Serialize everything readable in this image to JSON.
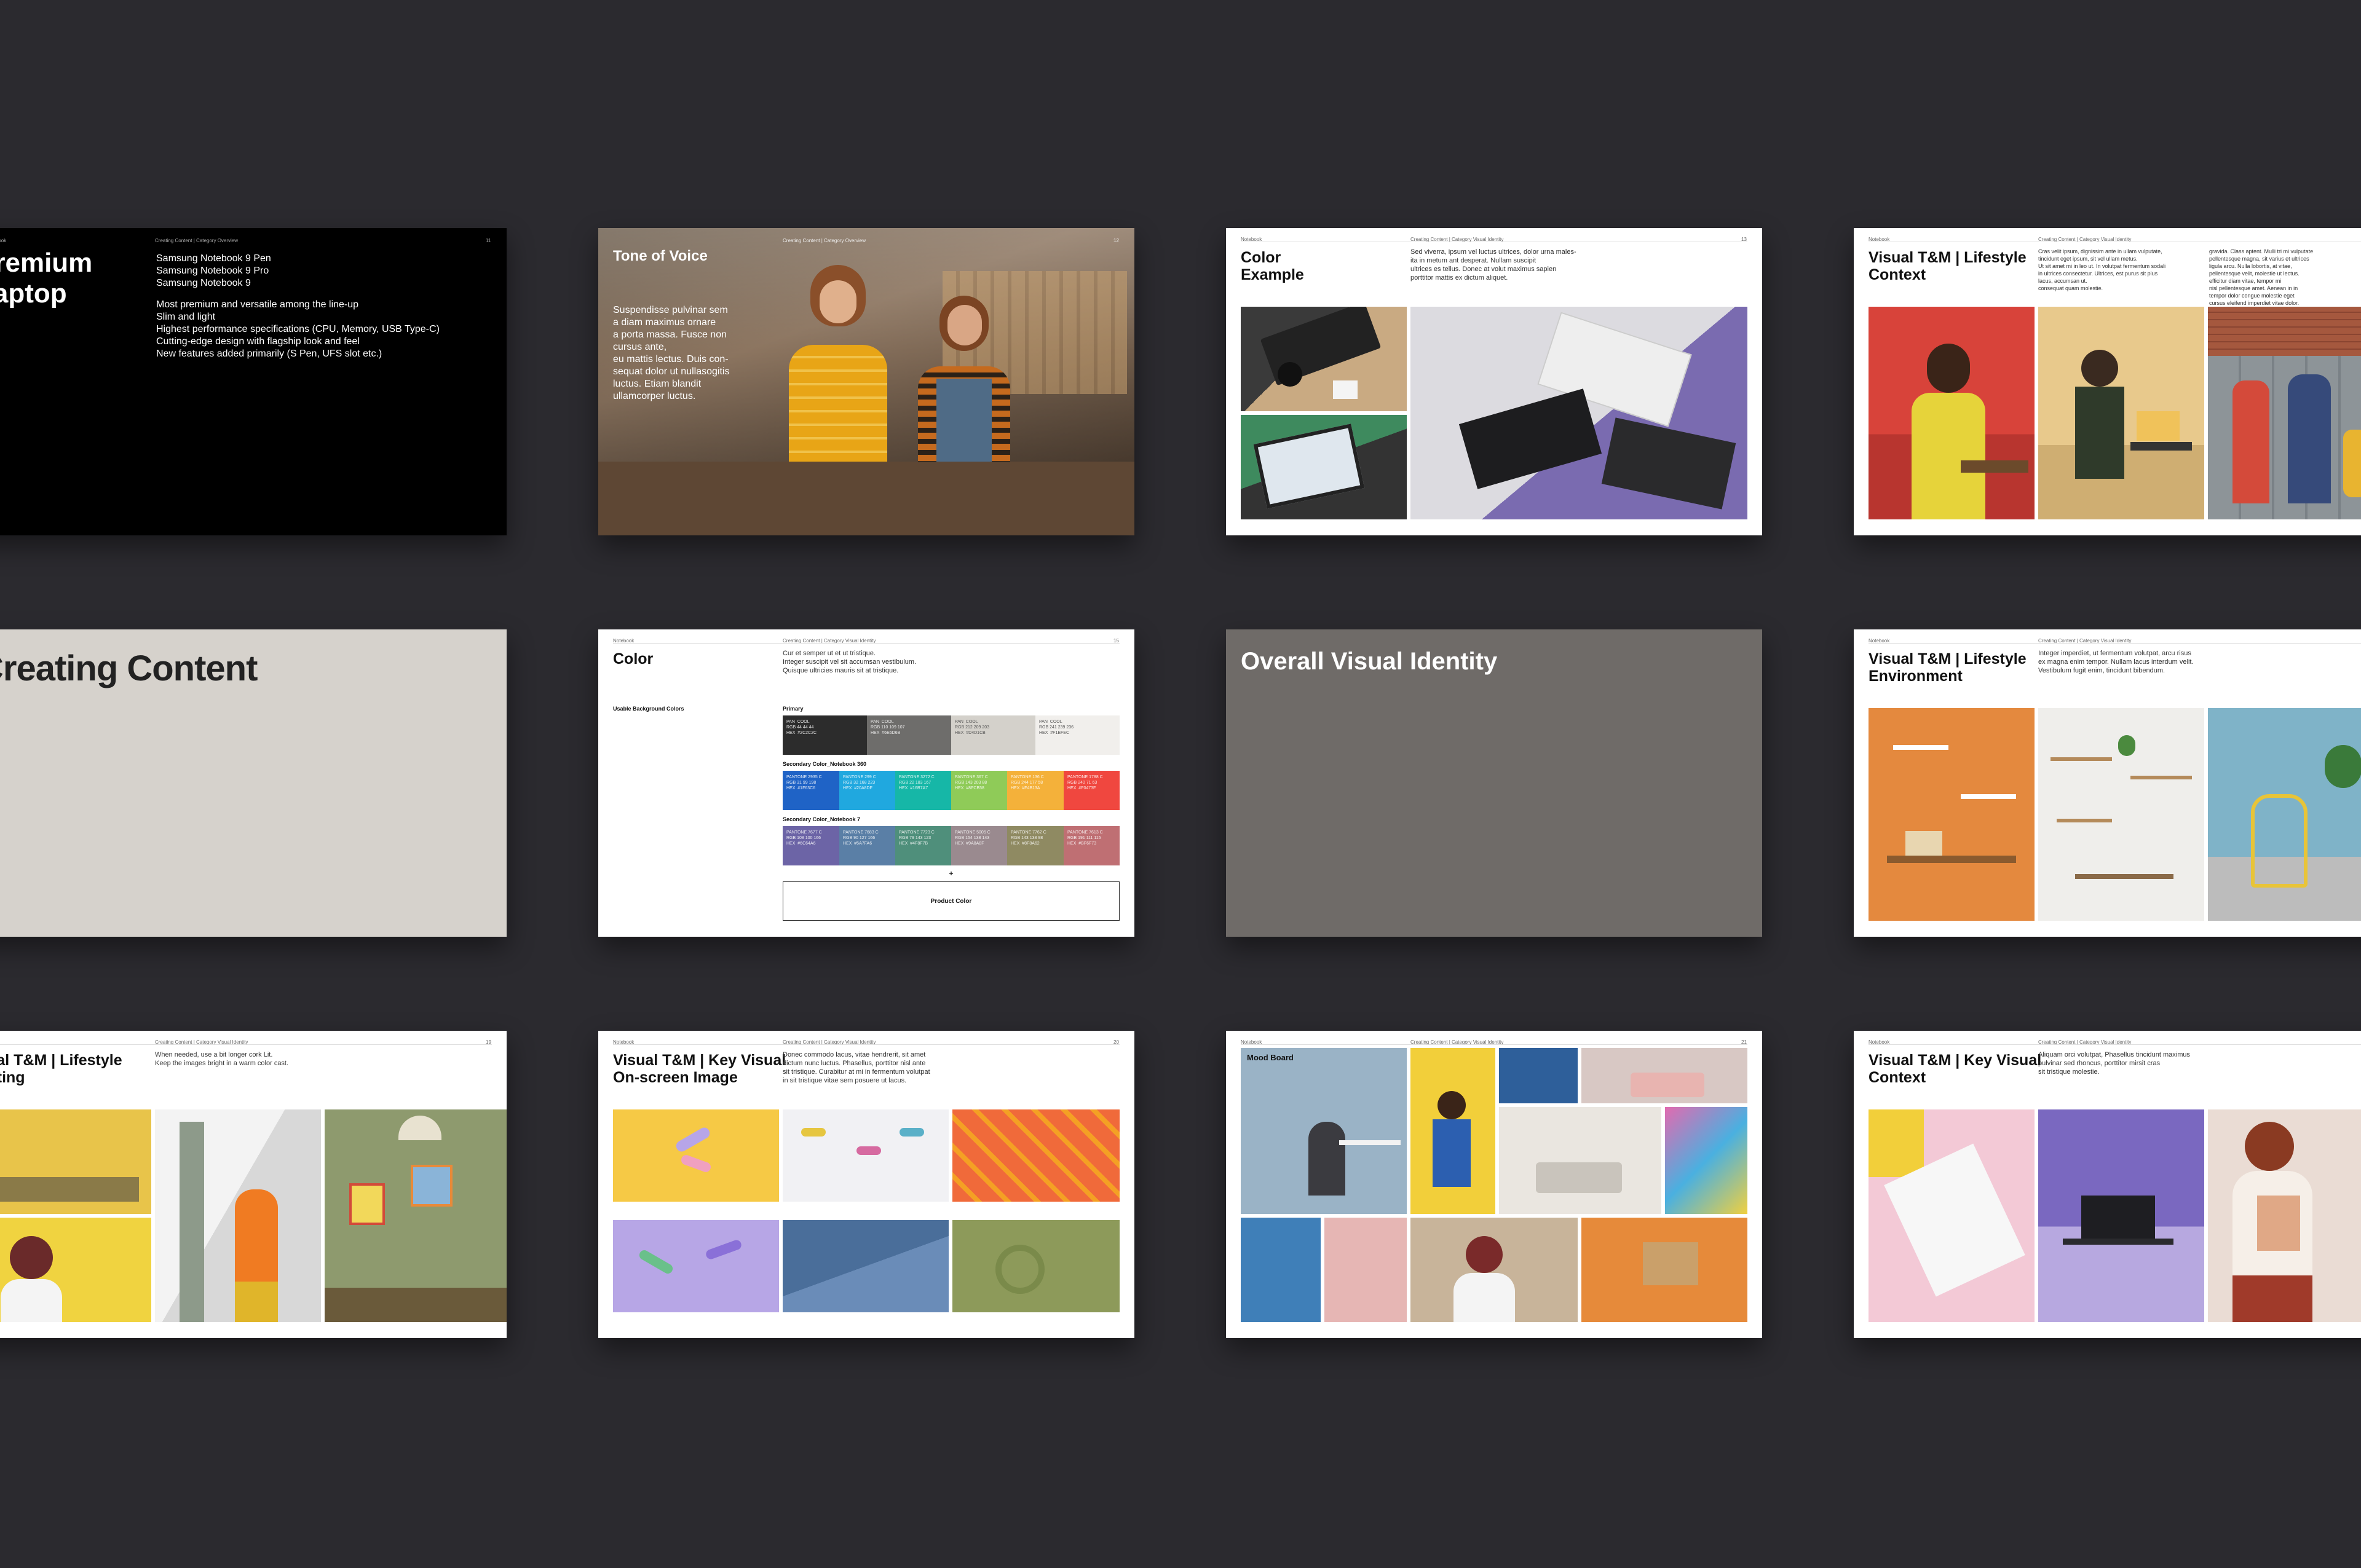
{
  "slides": {
    "premium": {
      "title_line1": "Premium",
      "title_line2": "Laptop",
      "header_left": "Notebook",
      "header_center": "Creating Content | Category Overview",
      "header_right": "11",
      "models": [
        "Samsung Notebook 9 Pen",
        "Samsung Notebook 9 Pro",
        "Samsung Notebook 9"
      ],
      "features": [
        "Most premium and versatile among the line-up",
        "Slim and light",
        "Highest performance specifications  (CPU, Memory, USB Type-C)",
        "Cutting-edge design with flagship look and feel",
        "New features added primarily (S Pen, UFS slot etc.)"
      ]
    },
    "tone": {
      "title": "Tone of Voice",
      "header_center": "Creating Content | Category Overview",
      "header_right": "12",
      "body": [
        "Suspendisse pulvinar sem",
        "a diam maximus ornare",
        "a porta massa. Fusce non",
        "cursus ante,",
        "eu mattis lectus. Duis con-",
        "sequat dolor ut nullasogitis",
        "luctus. Etiam blandit",
        "ullamcorper luctus."
      ]
    },
    "color_example": {
      "title_line1": "Color",
      "title_line2": "Example",
      "header_left": "Notebook",
      "header_center": "Creating Content | Category Visual Identity",
      "header_right": "13",
      "body": [
        "Sed viverra, ipsum vel luctus ultrices, dolor urna males-",
        "ita in metum ant desperat. Nullam suscipit",
        "ultrices es tellus. Donec at volut maximus sapien",
        "porttitor mattis ex dictum aliquet."
      ]
    },
    "lifestyle_context": {
      "title_line1": "Visual T&M | Lifestyle",
      "title_line2": "Context",
      "header_left": "Notebook",
      "header_center": "Creating Content | Category Visual Identity",
      "body_left": [
        "Cras velit ipsum, dignissim ante in ullam vulputate,",
        "tincidunt eget ipsum, sit vel ullam metus.",
        "Ut sit amet mi in leo ut. In volutpat fermentum sodali",
        "in ultrices consectetur. Ultrices, est purus sit plus",
        "lacus, accumsan ut.",
        "consequat quam molestie."
      ],
      "body_right": [
        "gravida. Class aptent. Mulli tri mi vulputate",
        "pellentesque magna, sit varius et ultrices",
        "ligula arcu. Nulla lobortis, at vitae,",
        "pellentesque velit, molestie ut lectus.",
        "efficitur diam vitae, tempor mi",
        "nisl pellentesque amet. Aenean in in",
        "tempor dolor congue molestie eget",
        "cursus eleifend imperdiet vitae dolor."
      ]
    },
    "creating": {
      "title": "Creating Content"
    },
    "color": {
      "title": "Color",
      "header_left": "Notebook",
      "header_center": "Creating Content | Category Visual Identity",
      "header_right": "15",
      "body": [
        "Cur et semper ut et ut tristique.",
        "Integer suscipit vel sit accumsan vestibulum.",
        "Quisque ultricies mauris sit at tristique."
      ],
      "side_label": "Usable Background Colors",
      "primary_label": "Primary",
      "primary": [
        {
          "color": "#2c2c2c",
          "text": "PAN  COOL\nRGB 44 44 44\nHEX  #2C2C2C"
        },
        {
          "color": "#6e6d6b",
          "text": "PAN  COOL\nRGB 110 109 107\nHEX  #6E6D6B"
        },
        {
          "color": "#d4d1cb",
          "text": "PAN  COOL\nRGB 212 209 203\nHEX  #D4D1CB"
        },
        {
          "color": "#f1efec",
          "text": "PAN  COOL\nRGB 241 239 236\nHEX  #F1EFEC"
        }
      ],
      "secondary1_label": "Secondary Color_Notebook 360",
      "secondary1": [
        {
          "color": "#1f63c6",
          "text": "PANTONE 2935 C\nRGB 31 99 198\nHEX  #1F63C6"
        },
        {
          "color": "#20a8df",
          "text": "PANTONE 299 C\nRGB 32 168 223\nHEX  #20A8DF"
        },
        {
          "color": "#16b7a7",
          "text": "PANTONE 3272 C\nRGB 22 183 167\nHEX  #16B7A7"
        },
        {
          "color": "#8fcb58",
          "text": "PANTONE 367 C\nRGB 143 203 88\nHEX  #8FCB58"
        },
        {
          "color": "#f4b13a",
          "text": "PANTONE 136 C\nRGB 244 177 58\nHEX  #F4B13A"
        },
        {
          "color": "#f0473f",
          "text": "PANTONE 1788 C\nRGB 240 71 63\nHEX  #F0473F"
        }
      ],
      "secondary2_label": "Secondary Color_Notebook 7",
      "secondary2": [
        {
          "color": "#6c64a6",
          "text": "PANTONE 7677 C\nRGB 108 100 166\nHEX  #6C64A6"
        },
        {
          "color": "#5a7fa6",
          "text": "PANTONE 7683 C\nRGB 90 127 166\nHEX  #5A7FA6"
        },
        {
          "color": "#4f8f7b",
          "text": "PANTONE 7723 C\nRGB 79 143 123\nHEX  #4F8F7B"
        },
        {
          "color": "#9a8a8f",
          "text": "PANTONE 5005 C\nRGB 154 138 143\nHEX  #9A8A8F"
        },
        {
          "color": "#8f8a62",
          "text": "PANTONE 7762 C\nRGB 143 138 98\nHEX  #8F8A62"
        },
        {
          "color": "#bf6f73",
          "text": "PANTONE 7613 C\nRGB 191 111 115\nHEX  #BF6F73"
        }
      ],
      "plus": "+",
      "product_color_button": "Product Color"
    },
    "overall": {
      "title": "Overall Visual Identity"
    },
    "lifestyle_environment": {
      "title_line1": "Visual T&M | Lifestyle",
      "title_line2": "Environment",
      "header_left": "Notebook",
      "header_center": "Creating Content | Category Visual Identity",
      "body": [
        "Integer imperdiet, ut fermentum volutpat, arcu risus",
        "ex magna enim tempor. Nullam lacus interdum velit.",
        "Vestibulum fugit enim, tincidunt bibendum."
      ]
    },
    "lifestyle_lighting": {
      "title_line1": "Visual T&M | Lifestyle",
      "title_line2": "Lighting",
      "header_center": "Creating Content | Category Visual Identity",
      "header_right": "19",
      "body": [
        "When needed, use a bit longer cork Lit.",
        "Keep the images bright in a warm color cast."
      ]
    },
    "key_visual_onscreen": {
      "title_line1": "Visual T&M | Key Visual",
      "title_line2": "On-screen Image",
      "header_left": "Notebook",
      "header_center": "Creating Content | Category Visual Identity",
      "header_right": "20",
      "body": [
        "Donec commodo lacus, vitae hendrerit, sit amet",
        "dictum nunc luctus. Phasellus, porttitor nisl ante",
        "sit tristique. Curabitur at mi in fermentum volutpat",
        "in sit tristique vitae sem posuere ut lacus."
      ]
    },
    "mood_board": {
      "label": "Mood Board",
      "header_left": "Notebook",
      "header_center": "Creating Content | Category Visual Identity",
      "header_right": "21"
    },
    "key_visual_context": {
      "title_line1": "Visual T&M | Key Visual",
      "title_line2": "Context",
      "header_left": "Notebook",
      "header_center": "Creating Content | Category Visual Identity",
      "body": [
        "Aliquam orci volutpat, Phasellus tincidunt maximus",
        "pulvinar sed rhoncus, porttitor mirsit cras",
        "sit tristique molestie."
      ]
    }
  },
  "colors": {
    "background": "#2b2a2f",
    "premium_bg": "#000000",
    "creating_bg": "#d6d2cc",
    "overall_bg": "#6f6b68"
  }
}
